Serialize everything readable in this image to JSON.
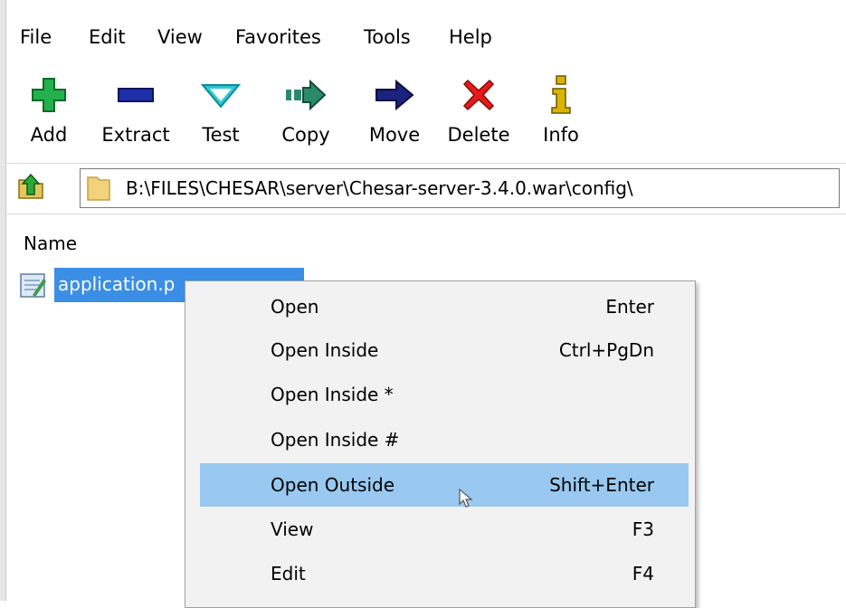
{
  "menubar": {
    "items": [
      "File",
      "Edit",
      "View",
      "Favorites",
      "Tools",
      "Help"
    ]
  },
  "toolbar": {
    "buttons": [
      {
        "label": "Add",
        "icon": "plus-icon",
        "color": "#22b14c"
      },
      {
        "label": "Extract",
        "icon": "minus-icon",
        "color": "#1f2fa8"
      },
      {
        "label": "Test",
        "icon": "check-icon",
        "color": "#2dc8d8"
      },
      {
        "label": "Copy",
        "icon": "copy-arrow-icon",
        "color": "#2b8a6a"
      },
      {
        "label": "Move",
        "icon": "move-arrow-icon",
        "color": "#1a237e"
      },
      {
        "label": "Delete",
        "icon": "x-icon",
        "color": "#e31b1b"
      },
      {
        "label": "Info",
        "icon": "info-icon",
        "color": "#d8b400"
      }
    ]
  },
  "addressbar": {
    "path": "B:\\FILES\\CHESAR\\server\\Chesar-server-3.4.0.war\\config\\"
  },
  "filelist": {
    "column_name": "Name",
    "selected_file": "application.p"
  },
  "context_menu": {
    "items": [
      {
        "label": "Open",
        "shortcut": "Enter"
      },
      {
        "label": "Open Inside",
        "shortcut": "Ctrl+PgDn"
      },
      {
        "label": "Open Inside *",
        "shortcut": ""
      },
      {
        "label": "Open Inside #",
        "shortcut": ""
      },
      {
        "label": "Open Outside",
        "shortcut": "Shift+Enter"
      },
      {
        "label": "View",
        "shortcut": "F3"
      },
      {
        "label": "Edit",
        "shortcut": "F4"
      }
    ],
    "highlighted": "Open Outside",
    "highlight_color": "#99c9f0"
  },
  "colors": {
    "selection": "#3a8ee6",
    "menu_background": "#f2f2f2"
  }
}
